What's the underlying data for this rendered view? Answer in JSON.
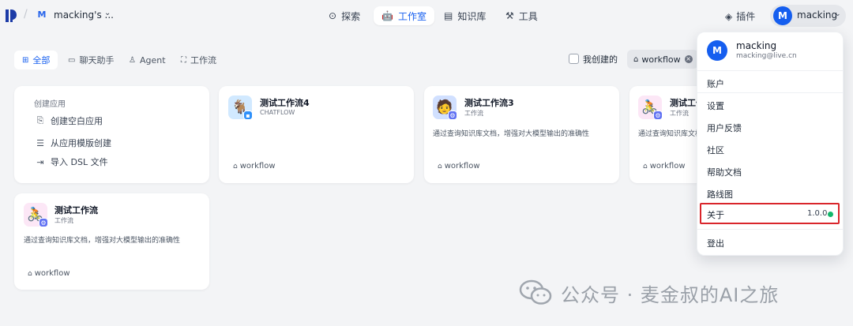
{
  "header": {
    "workspace_initial": "M",
    "workspace_name": "macking's ...",
    "nav": [
      {
        "label": "探索",
        "icon": "compass-icon"
      },
      {
        "label": "工作室",
        "icon": "robot-icon"
      },
      {
        "label": "知识库",
        "icon": "book-icon"
      },
      {
        "label": "工具",
        "icon": "hammer-icon"
      }
    ],
    "plugin_label": "插件",
    "user_initial": "M",
    "user_name": "macking"
  },
  "filters": {
    "tabs": [
      "全部",
      "聊天助手",
      "Agent",
      "工作流"
    ],
    "mine_label": "我创建的",
    "tag": "workflow"
  },
  "create": {
    "heading": "创建应用",
    "items": [
      "创建空白应用",
      "从应用模版创建",
      "导入 DSL 文件"
    ]
  },
  "apps": [
    {
      "title": "测试工作流4",
      "type": "CHATFLOW",
      "description": "",
      "tag": "workflow"
    },
    {
      "title": "测试工作流3",
      "type": "工作流",
      "description": "通过查询知识库文档，增强对大模型输出的准确性",
      "tag": "workflow"
    },
    {
      "title": "测试工作",
      "type": "工作流",
      "description": "通过查询知识库文档，增强对大模型输出的准确性",
      "tag": "workflow"
    },
    {
      "title": "测试工作流",
      "type": "工作流",
      "description": "通过查询知识库文档，增强对大模型输出的准确性",
      "tag": "workflow"
    }
  ],
  "user_menu": {
    "initial": "M",
    "name": "macking",
    "email": "macking@live.cn",
    "items": [
      "账户",
      "设置",
      "用户反馈",
      "社区",
      "帮助文档",
      "路线图"
    ],
    "about_label": "关于",
    "version": "1.0.0",
    "logout": "登出"
  },
  "watermark": "公众号 · 麦金叔的AI之旅",
  "colors": {
    "accent": "#155eef",
    "highlight": "#d9252b",
    "status": "#12b76a"
  }
}
